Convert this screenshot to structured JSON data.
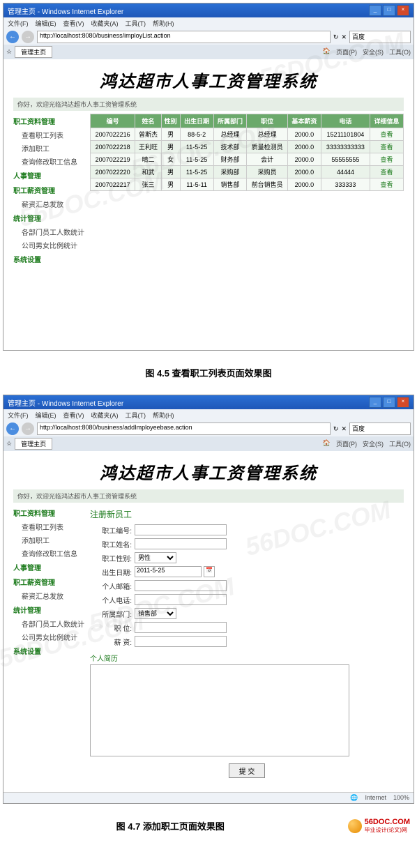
{
  "ie": {
    "windowTitle": "管理主页 - Windows Internet Explorer",
    "menus": [
      "文件(F)",
      "编辑(E)",
      "查看(V)",
      "收藏夹(A)",
      "工具(T)",
      "帮助(H)"
    ],
    "url1": "http://localhost:8080/business/imployList.action",
    "url2": "http://localhost:8080/business/addImployeebase.action",
    "searchPlaceholder": "百度",
    "tab": "管理主页",
    "toolbarRight": [
      "页面(P)",
      "安全(S)",
      "工具(O)"
    ],
    "statusInternet": "Internet",
    "statusZoom": "100%"
  },
  "app": {
    "banner": "鸿达超市人事工资管理系统",
    "welcome": "你好，欢迎光临鸿达超市人事工资管理系统"
  },
  "sidebar": {
    "groups": [
      {
        "head": "职工资料管理",
        "items": [
          "查看职工列表",
          "添加职工",
          "查询修改职工信息"
        ]
      },
      {
        "head": "人事管理",
        "items": []
      },
      {
        "head": "职工薪资管理",
        "items": [
          "薪资汇总发放"
        ]
      },
      {
        "head": "统计管理",
        "items": [
          "各部门员工人数统计",
          "公司男女比例统计"
        ]
      },
      {
        "head": "系统设置",
        "items": []
      }
    ]
  },
  "table": {
    "headers": [
      "编号",
      "姓名",
      "性别",
      "出生日期",
      "所属部门",
      "职位",
      "基本薪资",
      "电话",
      "详细信息"
    ],
    "rows": [
      [
        "2007022216",
        "曾斯杰",
        "男",
        "88-5-2",
        "总经理",
        "总经理",
        "2000.0",
        "15211101804",
        "查看"
      ],
      [
        "2007022218",
        "王利旺",
        "男",
        "11-5-25",
        "技术部",
        "质量检测员",
        "2000.0",
        "33333333333",
        "查看"
      ],
      [
        "2007022219",
        "晴二",
        "女",
        "11-5-25",
        "财务部",
        "会计",
        "2000.0",
        "55555555",
        "查看"
      ],
      [
        "2007022220",
        "和武",
        "男",
        "11-5-25",
        "采购部",
        "采购员",
        "2000.0",
        "44444",
        "查看"
      ],
      [
        "2007022217",
        "张三",
        "男",
        "11-5-11",
        "销售部",
        "前台销售员",
        "2000.0",
        "333333",
        "查看"
      ]
    ]
  },
  "caption1": "图 4.5  查看职工列表页面效果图",
  "caption2": "图 4.7  添加职工页面效果图",
  "form": {
    "title": "注册新员工",
    "labels": {
      "id": "职工编号:",
      "name": "职工姓名:",
      "gender": "职工性别:",
      "genderValue": "男性",
      "birth": "出生日期:",
      "birthValue": "2011-5-25",
      "email": "个人邮箱:",
      "phone": "个人电话:",
      "dept": "所属部门:",
      "deptValue": "销售部",
      "position": "职 位:",
      "salary": "薪 资:",
      "resume": "个人简历",
      "submit": "提  交"
    }
  },
  "watermark": "56DOC.COM",
  "footerLogo": {
    "top": "56DOC.COM",
    "bottom": "毕业设计(论文)网"
  }
}
